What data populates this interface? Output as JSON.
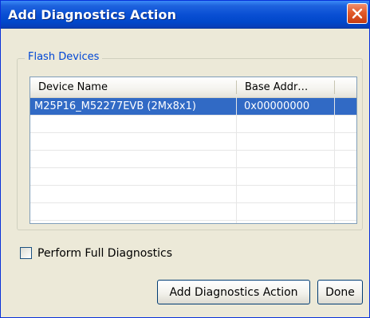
{
  "window": {
    "title": "Add Diagnostics Action"
  },
  "flash_devices": {
    "group_label": "Flash Devices",
    "columns": [
      "Device Name",
      "Base Addr…"
    ],
    "rows": [
      {
        "device_name": "M25P16_M52277EVB (2Mx8x1)",
        "base_addr": "0x00000000",
        "selected": true
      }
    ]
  },
  "options": {
    "full_diagnostics_label": "Perform Full Diagnostics",
    "full_diagnostics_checked": false
  },
  "buttons": {
    "add_label": "Add Diagnostics Action",
    "done_label": "Done"
  },
  "colors": {
    "title_bar": "#0a4fd4",
    "group_label": "#0046d5",
    "selection": "#316ac5",
    "close_button": "#e25a2a"
  }
}
